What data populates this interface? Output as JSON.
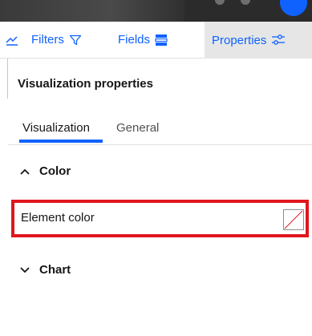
{
  "toolbar": {
    "filters_label": "Filters",
    "fields_label": "Fields",
    "properties_label": "Properties",
    "icons": {
      "trend": "trend-line-icon",
      "filters": "filter-icon",
      "fields": "fields-icon",
      "properties": "sliders-icon"
    }
  },
  "panel": {
    "title": "Visualization properties",
    "tabs": [
      {
        "label": "Visualization",
        "active": true
      },
      {
        "label": "General",
        "active": false
      }
    ],
    "sections": [
      {
        "label": "Color",
        "expanded": true,
        "properties": [
          {
            "label": "Element color",
            "value_icon": "no-color-swatch-icon"
          }
        ]
      },
      {
        "label": "Chart",
        "expanded": false
      }
    ]
  },
  "colors": {
    "accent": "#0f62fe",
    "highlight": "#e0161e",
    "active_tab_bg": "#e6e6e6",
    "top_bar": "#2b2b2b"
  }
}
